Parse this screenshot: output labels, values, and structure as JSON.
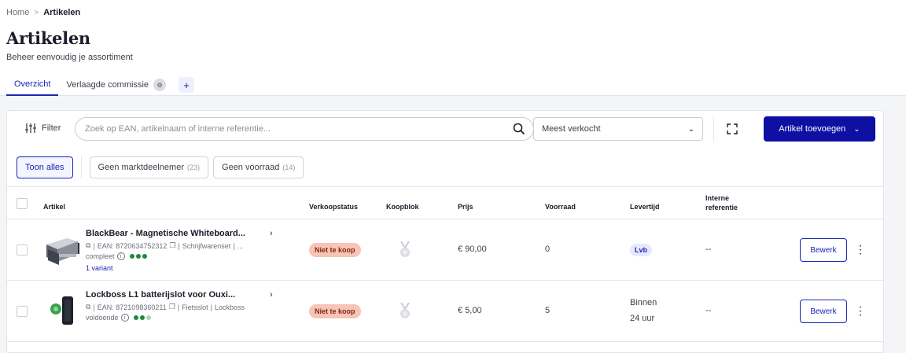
{
  "breadcrumb": {
    "home": "Home",
    "separator": ">",
    "current": "Artikelen"
  },
  "page": {
    "title": "Artikelen",
    "subtitle": "Beheer eenvoudig je assortiment"
  },
  "tabs": [
    {
      "label": "Overzicht",
      "active": true
    },
    {
      "label": "Verlaagde commissie",
      "badge_icon": "gear-icon"
    }
  ],
  "tab_add_label": "+",
  "toolbar": {
    "filter_label": "Filter",
    "search_placeholder": "Zoek op EAN, artikelnaam of interne referentie...",
    "sort_value": "Meest verkocht",
    "add_label": "Artikel toevoegen"
  },
  "chips": [
    {
      "label": "Toon alles",
      "count": "",
      "active": true
    },
    {
      "label": "Geen marktdeelnemer",
      "count": "(23)"
    },
    {
      "label": "Geen voorraad",
      "count": "(14)"
    }
  ],
  "columns": {
    "artikel": "Artikel",
    "verkoopstatus": "Verkoopstatus",
    "koopblok": "Koopblok",
    "prijs": "Prijs",
    "voorraad": "Voorraad",
    "levertijd": "Levertijd",
    "interne_referentie": "Interne referentie"
  },
  "rows": [
    {
      "name": "BlackBear - Magnetische Whiteboard...",
      "meta": "EAN: 8720634752312",
      "category": "Schrijfwarenset",
      "extra": "...",
      "quality": "compleet",
      "quality_level": 3,
      "variant": "1 variant",
      "status": "Niet te koop",
      "price": "€ 90,00",
      "stock": "0",
      "delivery": "Lvb",
      "reference": "--",
      "edit": "Bewerk"
    },
    {
      "name": "Lockboss L1 batterijslot voor Ouxi...",
      "meta": "EAN: 8721098360211",
      "category": "Fietsslot",
      "extra": "Lockboss",
      "quality": "voldoende",
      "quality_level": 2,
      "status": "Niet te koop",
      "price": "€ 5,00",
      "stock": "5",
      "delivery_line1": "Binnen",
      "delivery_line2": "24 uur",
      "reference": "--",
      "edit": "Bewerk"
    }
  ],
  "colors": {
    "primary": "#0e0fa3",
    "accent": "#1c24b8",
    "status_bg": "#f7c4b6",
    "quality_green": "#1d8a3a"
  }
}
